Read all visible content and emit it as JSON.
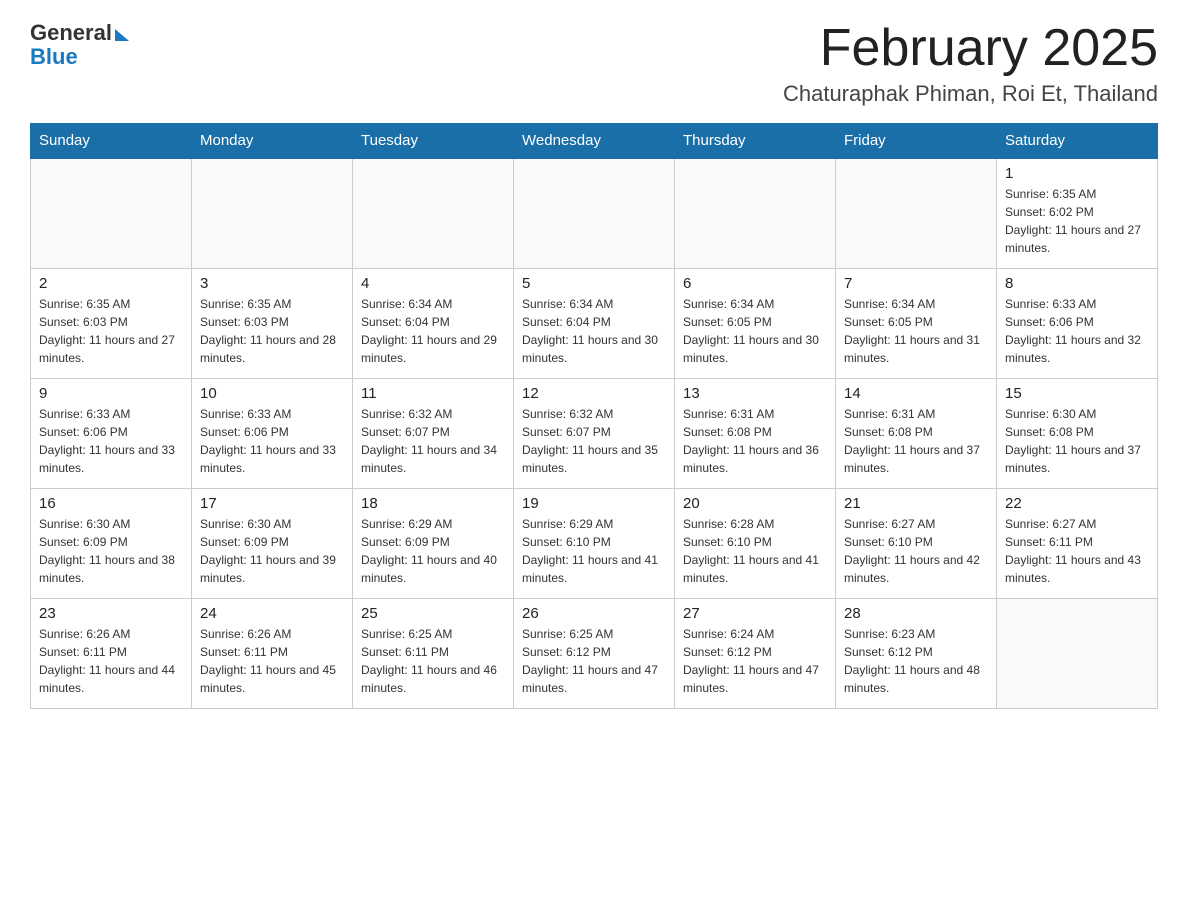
{
  "header": {
    "logo_general": "General",
    "logo_blue": "Blue",
    "month_title": "February 2025",
    "location": "Chaturaphak Phiman, Roi Et, Thailand"
  },
  "days_of_week": [
    "Sunday",
    "Monday",
    "Tuesday",
    "Wednesday",
    "Thursday",
    "Friday",
    "Saturday"
  ],
  "weeks": [
    [
      {
        "day": "",
        "info": ""
      },
      {
        "day": "",
        "info": ""
      },
      {
        "day": "",
        "info": ""
      },
      {
        "day": "",
        "info": ""
      },
      {
        "day": "",
        "info": ""
      },
      {
        "day": "",
        "info": ""
      },
      {
        "day": "1",
        "info": "Sunrise: 6:35 AM\nSunset: 6:02 PM\nDaylight: 11 hours and 27 minutes."
      }
    ],
    [
      {
        "day": "2",
        "info": "Sunrise: 6:35 AM\nSunset: 6:03 PM\nDaylight: 11 hours and 27 minutes."
      },
      {
        "day": "3",
        "info": "Sunrise: 6:35 AM\nSunset: 6:03 PM\nDaylight: 11 hours and 28 minutes."
      },
      {
        "day": "4",
        "info": "Sunrise: 6:34 AM\nSunset: 6:04 PM\nDaylight: 11 hours and 29 minutes."
      },
      {
        "day": "5",
        "info": "Sunrise: 6:34 AM\nSunset: 6:04 PM\nDaylight: 11 hours and 30 minutes."
      },
      {
        "day": "6",
        "info": "Sunrise: 6:34 AM\nSunset: 6:05 PM\nDaylight: 11 hours and 30 minutes."
      },
      {
        "day": "7",
        "info": "Sunrise: 6:34 AM\nSunset: 6:05 PM\nDaylight: 11 hours and 31 minutes."
      },
      {
        "day": "8",
        "info": "Sunrise: 6:33 AM\nSunset: 6:06 PM\nDaylight: 11 hours and 32 minutes."
      }
    ],
    [
      {
        "day": "9",
        "info": "Sunrise: 6:33 AM\nSunset: 6:06 PM\nDaylight: 11 hours and 33 minutes."
      },
      {
        "day": "10",
        "info": "Sunrise: 6:33 AM\nSunset: 6:06 PM\nDaylight: 11 hours and 33 minutes."
      },
      {
        "day": "11",
        "info": "Sunrise: 6:32 AM\nSunset: 6:07 PM\nDaylight: 11 hours and 34 minutes."
      },
      {
        "day": "12",
        "info": "Sunrise: 6:32 AM\nSunset: 6:07 PM\nDaylight: 11 hours and 35 minutes."
      },
      {
        "day": "13",
        "info": "Sunrise: 6:31 AM\nSunset: 6:08 PM\nDaylight: 11 hours and 36 minutes."
      },
      {
        "day": "14",
        "info": "Sunrise: 6:31 AM\nSunset: 6:08 PM\nDaylight: 11 hours and 37 minutes."
      },
      {
        "day": "15",
        "info": "Sunrise: 6:30 AM\nSunset: 6:08 PM\nDaylight: 11 hours and 37 minutes."
      }
    ],
    [
      {
        "day": "16",
        "info": "Sunrise: 6:30 AM\nSunset: 6:09 PM\nDaylight: 11 hours and 38 minutes."
      },
      {
        "day": "17",
        "info": "Sunrise: 6:30 AM\nSunset: 6:09 PM\nDaylight: 11 hours and 39 minutes."
      },
      {
        "day": "18",
        "info": "Sunrise: 6:29 AM\nSunset: 6:09 PM\nDaylight: 11 hours and 40 minutes."
      },
      {
        "day": "19",
        "info": "Sunrise: 6:29 AM\nSunset: 6:10 PM\nDaylight: 11 hours and 41 minutes."
      },
      {
        "day": "20",
        "info": "Sunrise: 6:28 AM\nSunset: 6:10 PM\nDaylight: 11 hours and 41 minutes."
      },
      {
        "day": "21",
        "info": "Sunrise: 6:27 AM\nSunset: 6:10 PM\nDaylight: 11 hours and 42 minutes."
      },
      {
        "day": "22",
        "info": "Sunrise: 6:27 AM\nSunset: 6:11 PM\nDaylight: 11 hours and 43 minutes."
      }
    ],
    [
      {
        "day": "23",
        "info": "Sunrise: 6:26 AM\nSunset: 6:11 PM\nDaylight: 11 hours and 44 minutes."
      },
      {
        "day": "24",
        "info": "Sunrise: 6:26 AM\nSunset: 6:11 PM\nDaylight: 11 hours and 45 minutes."
      },
      {
        "day": "25",
        "info": "Sunrise: 6:25 AM\nSunset: 6:11 PM\nDaylight: 11 hours and 46 minutes."
      },
      {
        "day": "26",
        "info": "Sunrise: 6:25 AM\nSunset: 6:12 PM\nDaylight: 11 hours and 47 minutes."
      },
      {
        "day": "27",
        "info": "Sunrise: 6:24 AM\nSunset: 6:12 PM\nDaylight: 11 hours and 47 minutes."
      },
      {
        "day": "28",
        "info": "Sunrise: 6:23 AM\nSunset: 6:12 PM\nDaylight: 11 hours and 48 minutes."
      },
      {
        "day": "",
        "info": ""
      }
    ]
  ]
}
